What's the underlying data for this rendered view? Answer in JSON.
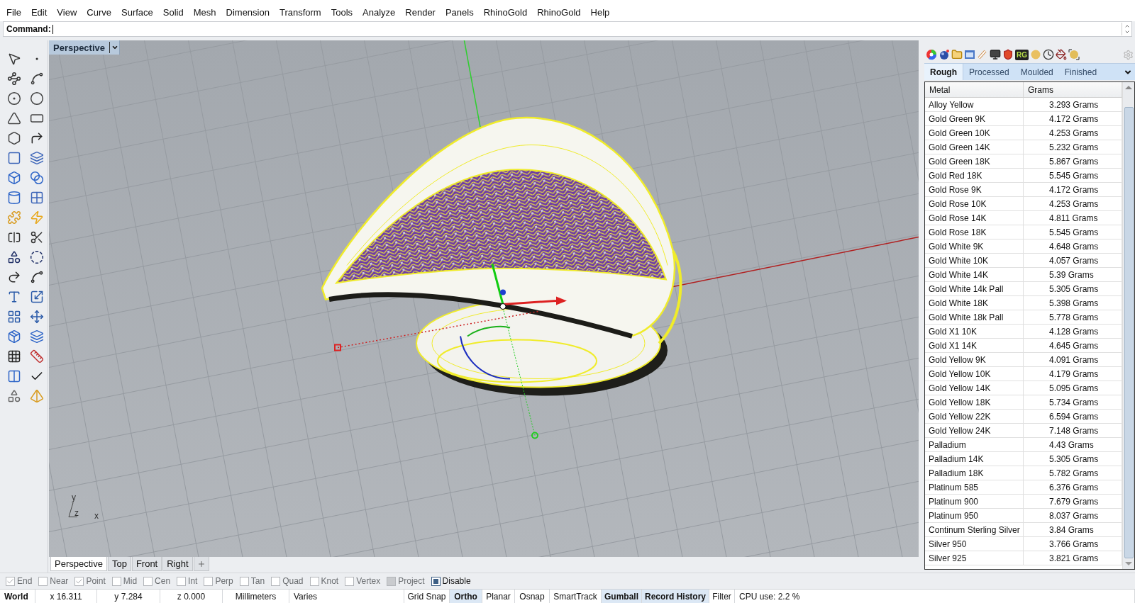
{
  "menu": [
    "File",
    "Edit",
    "View",
    "Curve",
    "Surface",
    "Solid",
    "Mesh",
    "Dimension",
    "Transform",
    "Tools",
    "Analyze",
    "Render",
    "Panels",
    "RhinoGold",
    "RhinoGold",
    "Help"
  ],
  "command": {
    "label": "Command:"
  },
  "viewport": {
    "title": "Perspective",
    "axis_labels": [
      "y",
      "z",
      "x"
    ],
    "tabs": [
      {
        "label": "Perspective",
        "selected": true
      },
      {
        "label": "Top",
        "selected": false
      },
      {
        "label": "Front",
        "selected": false
      },
      {
        "label": "Right",
        "selected": false
      }
    ]
  },
  "panel": {
    "logo_text": "RG",
    "tabs": [
      {
        "label": "Rough",
        "selected": true
      },
      {
        "label": "Processed",
        "selected": false
      },
      {
        "label": "Moulded",
        "selected": false
      },
      {
        "label": "Finished",
        "selected": false
      }
    ],
    "table": {
      "columns": [
        "Metal",
        "Grams"
      ],
      "rows": [
        [
          "Alloy Yellow",
          "3.293 Grams"
        ],
        [
          "Gold Green 9K",
          "4.172 Grams"
        ],
        [
          "Gold Green 10K",
          "4.253 Grams"
        ],
        [
          "Gold Green 14K",
          "5.232 Grams"
        ],
        [
          "Gold Green 18K",
          "5.867 Grams"
        ],
        [
          "Gold Red 18K",
          "5.545 Grams"
        ],
        [
          "Gold Rose 9K",
          "4.172 Grams"
        ],
        [
          "Gold Rose 10K",
          "4.253 Grams"
        ],
        [
          "Gold Rose 14K",
          "4.811 Grams"
        ],
        [
          "Gold Rose 18K",
          "5.545 Grams"
        ],
        [
          "Gold White 9K",
          "4.648 Grams"
        ],
        [
          "Gold White 10K",
          "4.057 Grams"
        ],
        [
          "Gold White 14K",
          "5.39 Grams"
        ],
        [
          "Gold White 14k Pall",
          "5.305 Grams"
        ],
        [
          "Gold White 18K",
          "5.398 Grams"
        ],
        [
          "Gold White 18k Pall",
          "5.778 Grams"
        ],
        [
          "Gold X1 10K",
          "4.128 Grams"
        ],
        [
          "Gold X1 14K",
          "4.645 Grams"
        ],
        [
          "Gold Yellow 9K",
          "4.091 Grams"
        ],
        [
          "Gold Yellow 10K",
          "4.179 Grams"
        ],
        [
          "Gold Yellow 14K",
          "5.095 Grams"
        ],
        [
          "Gold Yellow 18K",
          "5.734 Grams"
        ],
        [
          "Gold Yellow 22K",
          "6.594 Grams"
        ],
        [
          "Gold Yellow 24K",
          "7.148 Grams"
        ],
        [
          "Palladium",
          "4.43 Grams"
        ],
        [
          "Palladium 14K",
          "5.305 Grams"
        ],
        [
          "Palladium 18K",
          "5.782 Grams"
        ],
        [
          "Platinum 585",
          "6.376 Grams"
        ],
        [
          "Platinum 900",
          "7.679 Grams"
        ],
        [
          "Platinum 950",
          "8.037 Grams"
        ],
        [
          "Continum Sterling Silver",
          "3.84 Grams"
        ],
        [
          "Silver 950",
          "3.766 Grams"
        ],
        [
          "Silver 925",
          "3.821 Grams"
        ]
      ]
    }
  },
  "osnaps": [
    {
      "label": "End",
      "checked": true,
      "disabled": false
    },
    {
      "label": "Near",
      "checked": false,
      "disabled": false
    },
    {
      "label": "Point",
      "checked": true,
      "disabled": false
    },
    {
      "label": "Mid",
      "checked": false,
      "disabled": false
    },
    {
      "label": "Cen",
      "checked": false,
      "disabled": false
    },
    {
      "label": "Int",
      "checked": false,
      "disabled": false
    },
    {
      "label": "Perp",
      "checked": false,
      "disabled": false
    },
    {
      "label": "Tan",
      "checked": false,
      "disabled": false
    },
    {
      "label": "Quad",
      "checked": false,
      "disabled": false
    },
    {
      "label": "Knot",
      "checked": false,
      "disabled": false
    },
    {
      "label": "Vertex",
      "checked": false,
      "disabled": false
    },
    {
      "label": "Project",
      "checked": false,
      "disabled": true
    }
  ],
  "osnap_disable": {
    "label": "Disable",
    "checked": true
  },
  "status_bar": {
    "plane": "World",
    "coords": [
      "x 16.311",
      "y 7.284",
      "z 0.000"
    ],
    "units": "Millimeters",
    "layer": "Varies",
    "toggles": [
      {
        "label": "Grid Snap",
        "on": false
      },
      {
        "label": "Ortho",
        "on": true
      },
      {
        "label": "Planar",
        "on": false
      },
      {
        "label": "Osnap",
        "on": false
      },
      {
        "label": "SmartTrack",
        "on": false
      },
      {
        "label": "Gumball",
        "on": true
      },
      {
        "label": "Record History",
        "on": true
      },
      {
        "label": "Filter",
        "on": false
      }
    ],
    "cpu": "CPU use: 2.2 %"
  }
}
